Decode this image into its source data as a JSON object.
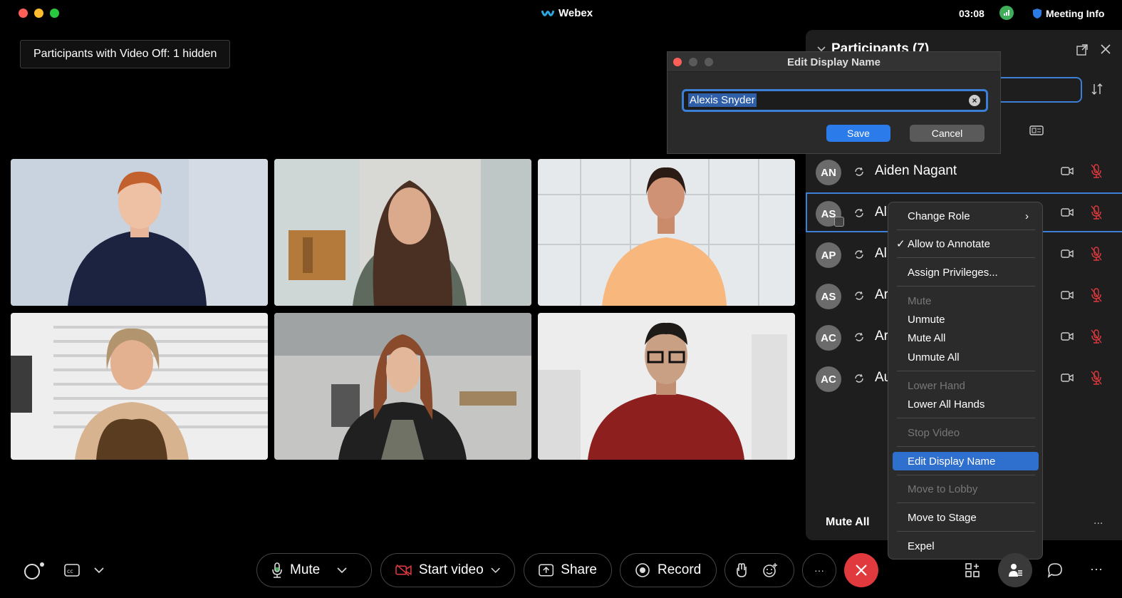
{
  "titlebar": {
    "app_name": "Webex",
    "time": "03:08",
    "meeting_info": "Meeting Info"
  },
  "stage": {
    "video_off_label": "Participants with Video Off:  1 hidden"
  },
  "panel": {
    "title": "Participants (7)",
    "participants": [
      {
        "initials": "AN",
        "name": "Aiden Nagant"
      },
      {
        "initials": "AS",
        "name": "Al"
      },
      {
        "initials": "AP",
        "name": "Al"
      },
      {
        "initials": "AS",
        "name": "Ar"
      },
      {
        "initials": "AC",
        "name": "Ar"
      },
      {
        "initials": "AC",
        "name": "Au"
      }
    ],
    "mute_all": "Mute All",
    "more": "..."
  },
  "context_menu": {
    "change_role": "Change Role",
    "allow_annotate": "Allow to Annotate",
    "assign_privileges": "Assign Privileges...",
    "mute": "Mute",
    "unmute": "Unmute",
    "mute_all": "Mute All",
    "unmute_all": "Unmute All",
    "lower_hand": "Lower Hand",
    "lower_all_hands": "Lower All Hands",
    "stop_video": "Stop Video",
    "edit_display_name": "Edit Display Name",
    "move_to_lobby": "Move to Lobby",
    "move_to_stage": "Move to Stage",
    "expel": "Expel"
  },
  "dialog": {
    "title": "Edit Display Name",
    "value": "Alexis Snyder",
    "save": "Save",
    "cancel": "Cancel"
  },
  "controls": {
    "mute": "Mute",
    "start_video": "Start video",
    "share": "Share",
    "record": "Record",
    "more": "···"
  },
  "colors": {
    "accent": "#3b7fd6",
    "end_call": "#e0393e",
    "highlight": "#2f6fcd"
  }
}
